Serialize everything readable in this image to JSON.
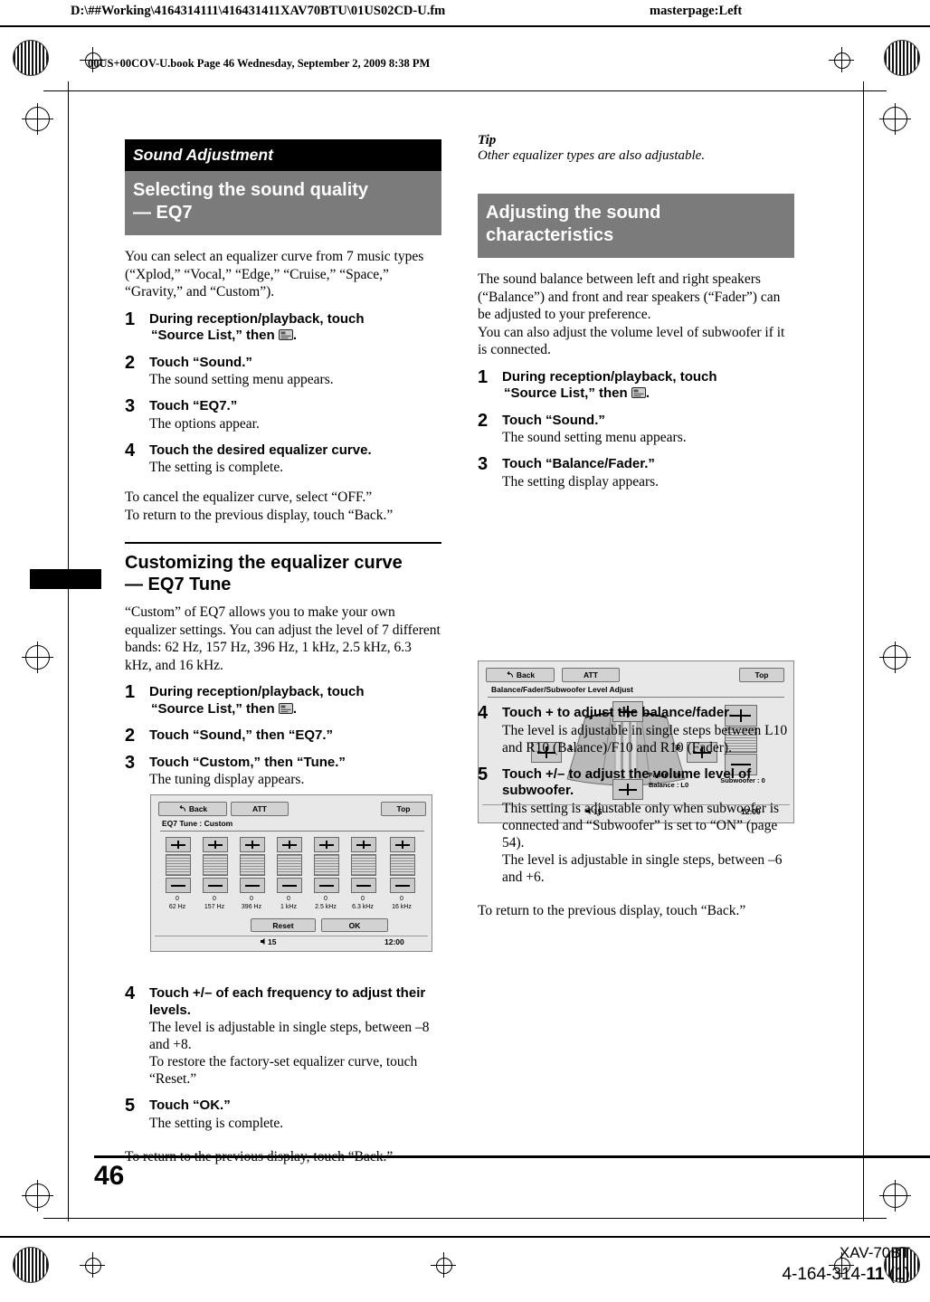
{
  "header": {
    "file_path": "D:\\##Working\\4164314111\\416431411XAV70BTU\\01US02CD-U.fm",
    "masterpage": "masterpage:Left",
    "book_line": "00US+00COV-U.book  Page 46  Wednesday, September 2, 2009  8:38 PM"
  },
  "footer": {
    "page_number": "46",
    "model": "XAV-70BT",
    "part_number_prefix": "4-164-314-",
    "part_number_bold": "11",
    "part_number_suffix": " (1)"
  },
  "left_column": {
    "chapter_bar": "Sound Adjustment",
    "section_bar": "Selecting the sound quality\n— EQ7",
    "intro": "You can select an equalizer curve from 7 music types (“Xplod,” “Vocal,” “Edge,” “Cruise,” “Space,” “Gravity,” and “Custom”).",
    "steps": [
      {
        "num": "1",
        "title": "During reception/playback, touch “Source List,” then  .",
        "desc": ""
      },
      {
        "num": "2",
        "title": "Touch “Sound.”",
        "desc": "The sound setting menu appears."
      },
      {
        "num": "3",
        "title": "Touch “EQ7.”",
        "desc": "The options appear."
      },
      {
        "num": "4",
        "title": "Touch the desired equalizer curve.",
        "desc": "The setting is complete."
      }
    ],
    "after_steps": "To cancel the equalizer curve, select “OFF.”\nTo return to the previous display, touch “Back.”",
    "subsection_heading": "Customizing the equalizer curve\n— EQ7 Tune",
    "subsection_intro": "“Custom” of EQ7 allows you to make your own equalizer settings. You can adjust the level of 7 different bands: 62 Hz, 157 Hz, 396 Hz, 1 kHz, 2.5 kHz, 6.3 kHz, and 16 kHz.",
    "steps2": [
      {
        "num": "1",
        "title": "During reception/playback, touch “Source List,” then  .",
        "desc": ""
      },
      {
        "num": "2",
        "title": "Touch “Sound,” then “EQ7.”",
        "desc": ""
      },
      {
        "num": "3",
        "title": "Touch “Custom,” then “Tune.”",
        "desc": "The tuning display appears."
      }
    ],
    "steps3": [
      {
        "num": "4",
        "title": "Touch +/– of each frequency to adjust their levels.",
        "desc": "The level is adjustable in single steps, between –8 and +8.\nTo restore the factory-set equalizer curve, touch “Reset.”"
      },
      {
        "num": "5",
        "title": "Touch “OK.”",
        "desc": "The setting is complete."
      }
    ],
    "closing": "To return to the previous display, touch “Back.”"
  },
  "eq_screen": {
    "back_label": "Back",
    "att_label": "ATT",
    "top_label": "Top",
    "title": "EQ7 Tune : Custom",
    "bands": [
      {
        "value": "0",
        "freq": "62 Hz"
      },
      {
        "value": "0",
        "freq": "157 Hz"
      },
      {
        "value": "0",
        "freq": "396 Hz"
      },
      {
        "value": "0",
        "freq": "1 kHz"
      },
      {
        "value": "0",
        "freq": "2.5 kHz"
      },
      {
        "value": "0",
        "freq": "6.3 kHz"
      },
      {
        "value": "0",
        "freq": "16 kHz"
      }
    ],
    "reset_label": "Reset",
    "ok_label": "OK",
    "volume": "15",
    "clock": "12:00"
  },
  "right_column": {
    "tip_label": "Tip",
    "tip_text": "Other equalizer types are also adjustable.",
    "section_bar": "Adjusting the sound\ncharacteristics",
    "intro": "The sound balance between left and right speakers (“Balance”) and front and rear speakers (“Fader”) can be adjusted to your preference.\nYou can also adjust the volume level of subwoofer if it is connected.",
    "steps": [
      {
        "num": "1",
        "title": "During reception/playback, touch “Source List,” then  .",
        "desc": ""
      },
      {
        "num": "2",
        "title": "Touch “Sound.”",
        "desc": "The sound setting menu appears."
      },
      {
        "num": "3",
        "title": "Touch “Balance/Fader.”",
        "desc": "The setting display appears."
      }
    ],
    "steps2": [
      {
        "num": "4",
        "title": "Touch + to adjust the balance/fader.",
        "desc": "The level is adjustable in single steps between L10 and R10 (Balance)/F10 and R10 (Fader)."
      },
      {
        "num": "5",
        "title": "Touch +/– to adjust the volume level of subwoofer.",
        "desc": "This setting is adjustable only when subwoofer is connected and “Subwoofer” is set to “ON” (page 54).\nThe level is adjustable in single steps, between –6 and +6."
      }
    ],
    "closing": "To return to the previous display, touch “Back.”"
  },
  "balance_screen": {
    "back_label": "Back",
    "att_label": "ATT",
    "top_label": "Top",
    "title": "Balance/Fader/Subwoofer Level Adjust",
    "left_mark": "L",
    "right_mark": "R",
    "fader_value": "Fader : F0",
    "balance_value": "Balance : L0",
    "subwoofer_label": "Subwoofer : 0",
    "volume": "15",
    "clock": "12:00"
  }
}
